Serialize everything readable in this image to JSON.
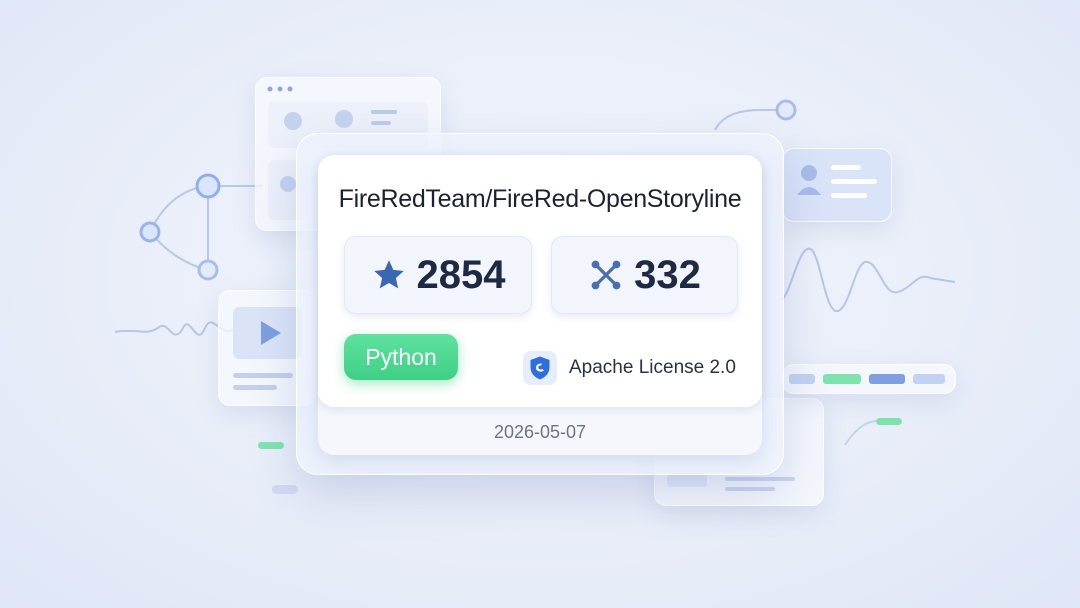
{
  "repo": {
    "full_name": "FireRedTeam/FireRed-OpenStoryline",
    "stars": "2854",
    "forks": "332",
    "language": "Python",
    "license": "Apache License 2.0",
    "date": "2026-05-07"
  },
  "icons": {
    "stars": "star-icon",
    "forks": "fork-icon",
    "license": "shield-icon"
  },
  "colors": {
    "language_badge": "#3fcf86",
    "star": "#3a67b5",
    "fork": "#4a6fae",
    "shield": "#2f6de0"
  }
}
